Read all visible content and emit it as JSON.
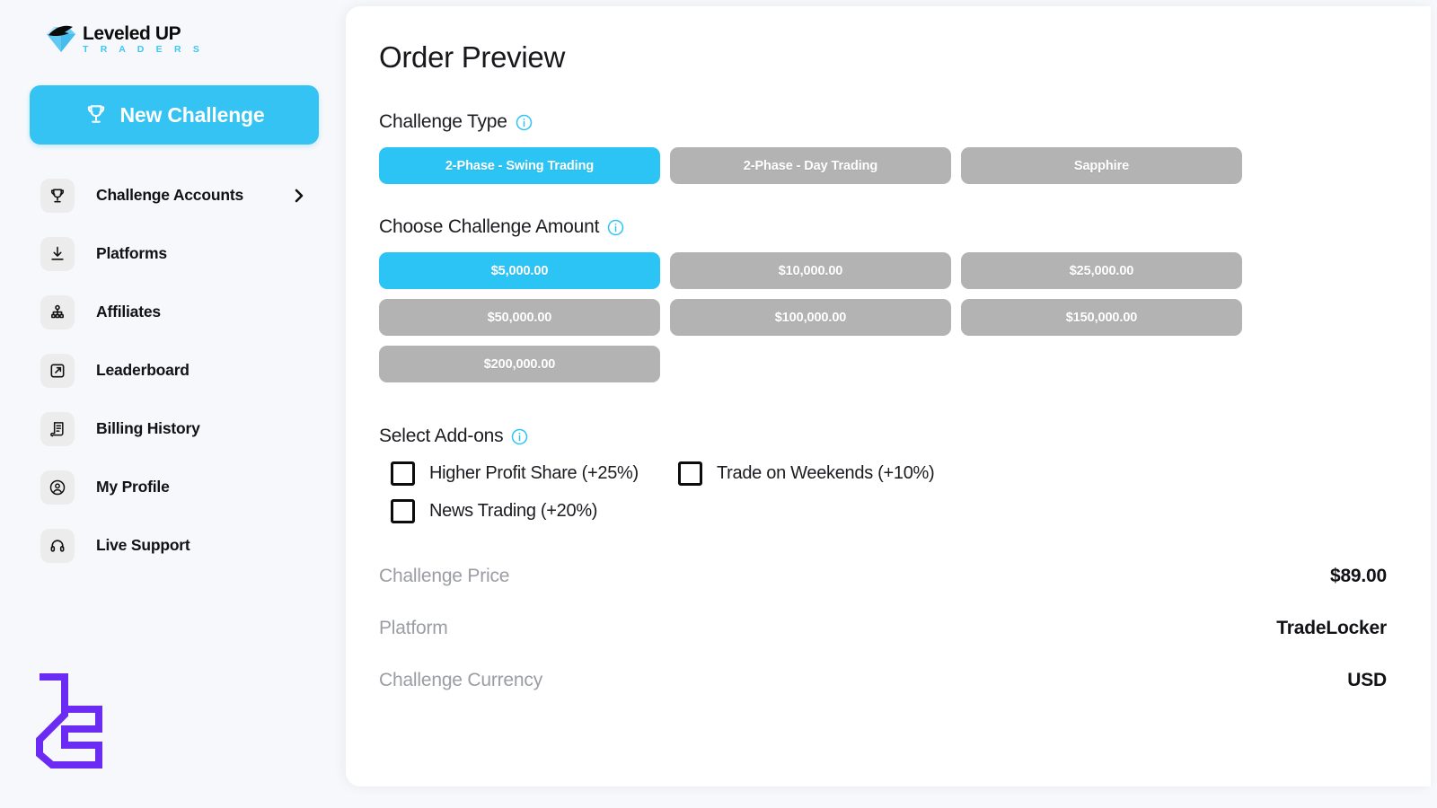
{
  "brand": {
    "name_top": "Leveled UP",
    "name_bottom": "T R A D E R S",
    "icon": "diamond-gem-icon",
    "accent_color": "#3cc7f4"
  },
  "sidebar": {
    "new_challenge": {
      "label": "New Challenge",
      "icon": "trophy-icon",
      "color": "#35c3f3"
    },
    "items": [
      {
        "label": "Challenge Accounts",
        "icon": "trophy-icon",
        "has_chevron": true
      },
      {
        "label": "Platforms",
        "icon": "download-icon",
        "has_chevron": false
      },
      {
        "label": "Affiliates",
        "icon": "org-chart-icon",
        "has_chevron": false
      },
      {
        "label": "Leaderboard",
        "icon": "external-link-icon",
        "has_chevron": false
      },
      {
        "label": "Billing History",
        "icon": "receipt-icon",
        "has_chevron": false
      },
      {
        "label": "My Profile",
        "icon": "user-circle-icon",
        "has_chevron": false
      },
      {
        "label": "Live Support",
        "icon": "headset-icon",
        "has_chevron": false
      }
    ],
    "footer_logo": {
      "name": "lc-monogram-logo",
      "color": "#6c2bf2"
    }
  },
  "main": {
    "title": "Order Preview",
    "challenge_type": {
      "heading": "Challenge Type",
      "info_icon": "info-icon",
      "options": [
        {
          "label": "2-Phase - Swing Trading",
          "selected": true
        },
        {
          "label": "2-Phase - Day Trading",
          "selected": false
        },
        {
          "label": "Sapphire",
          "selected": false
        }
      ]
    },
    "challenge_amount": {
      "heading": "Choose Challenge Amount",
      "info_icon": "info-icon",
      "options": [
        {
          "label": "$5,000.00",
          "selected": true
        },
        {
          "label": "$10,000.00",
          "selected": false
        },
        {
          "label": "$25,000.00",
          "selected": false
        },
        {
          "label": "$50,000.00",
          "selected": false
        },
        {
          "label": "$100,000.00",
          "selected": false
        },
        {
          "label": "$150,000.00",
          "selected": false
        },
        {
          "label": "$200,000.00",
          "selected": false
        }
      ]
    },
    "addons": {
      "heading": "Select Add-ons",
      "info_icon": "info-icon",
      "options": [
        {
          "label": "Higher Profit Share (+25%)",
          "checked": false
        },
        {
          "label": "Trade on Weekends (+10%)",
          "checked": false
        },
        {
          "label": "News Trading (+20%)",
          "checked": false
        }
      ]
    },
    "summary": [
      {
        "key": "Challenge Price",
        "value": "$89.00"
      },
      {
        "key": "Platform",
        "value": "TradeLocker"
      },
      {
        "key": "Challenge Currency",
        "value": "USD"
      }
    ]
  },
  "colors": {
    "accent_cyan": "#2cc4f4",
    "inactive_gray": "#b3b3b3",
    "page_bg": "#f7f8fb",
    "card_bg": "#ffffff",
    "muted_text": "#9b9da4"
  }
}
